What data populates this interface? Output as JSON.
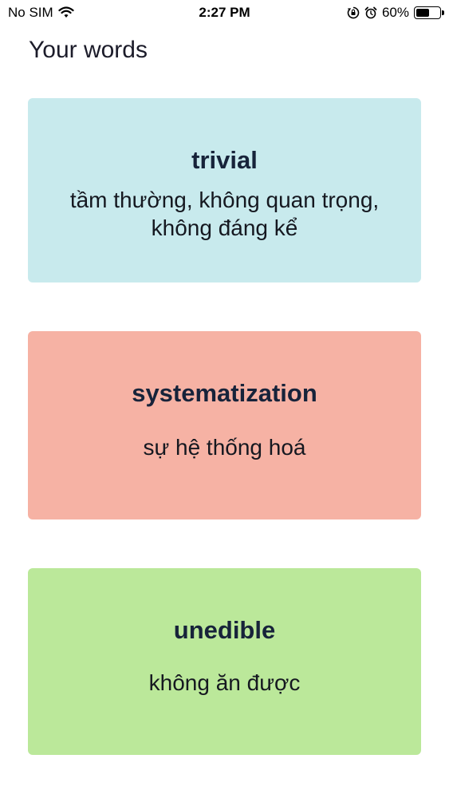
{
  "status_bar": {
    "carrier": "No SIM",
    "time": "2:27 PM",
    "battery_percent": "60%",
    "battery_level": 0.6,
    "icons": [
      "wifi-icon",
      "orientation-lock-icon",
      "alarm-icon",
      "battery-icon"
    ]
  },
  "page": {
    "title": "Your words"
  },
  "cards": [
    {
      "word": "trivial",
      "meaning": "tầm thường, không quan trọng, không đáng kể",
      "color": "#c8eaed"
    },
    {
      "word": "systematization",
      "meaning": "sự hệ thống hoá",
      "color": "#f6b2a4"
    },
    {
      "word": "unedible",
      "meaning": "không ăn được",
      "color": "#bbe89a"
    }
  ]
}
